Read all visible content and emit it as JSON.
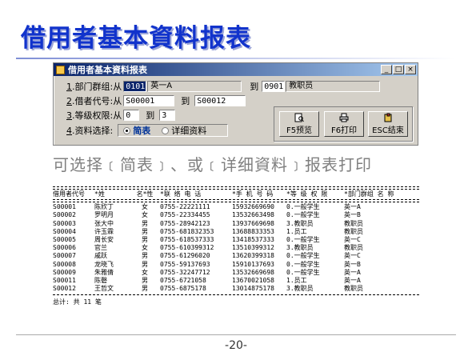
{
  "slide_title": "借用者基本資料报表",
  "window": {
    "title": "借用者基本資料报表",
    "buttons": [
      "_",
      "□",
      "×"
    ]
  },
  "form": {
    "dept": {
      "num": "1",
      "label": ".部门群组:从",
      "from_code": "0101",
      "from_name": "英一A",
      "to_label": "到",
      "to_code": "0901",
      "to_name": "教职员"
    },
    "borrower": {
      "num": "2",
      "label": ".借者代号:从",
      "from": "S00001",
      "to_label": "到",
      "to": "S00012"
    },
    "level": {
      "num": "3",
      "label": ".等级权限:从",
      "from": "0",
      "to_label": "到",
      "to": "3"
    },
    "data_select": {
      "num": "4",
      "label": ".资料选择:",
      "option1": "简表",
      "option2": "详细资料"
    }
  },
  "toolbar": {
    "preview": "F5预览",
    "print": "F6打印",
    "exit": "ESC结束"
  },
  "caption": "可选择﹝简表﹞、或﹝详细資料﹞报表打印",
  "report": {
    "headers": [
      "借用者代号",
      "*姓",
      "名*性",
      "*联  络    电  话",
      "*手  机    号  码",
      "*等 级   权 限",
      "*部门群组  名  称"
    ],
    "rows": [
      [
        "S00001",
        "陈欣丁",
        "女",
        "0755-22221111",
        "15932669690",
        "0.一般学生",
        "英一A"
      ],
      [
        "S00002",
        "罗明月",
        "女",
        "0755-22334455",
        "13532663498",
        "0.一般学生",
        "英一B"
      ],
      [
        "S00003",
        "张大中",
        "男",
        "0755-28942123",
        "13937669698",
        "3.教职员",
        "教职员"
      ],
      [
        "S00004",
        "许玉霖",
        "男",
        "0755-681832353",
        "13688833353",
        "1.员工",
        "教职员"
      ],
      [
        "S00005",
        "周长安",
        "男",
        "0755-618537333",
        "13418537333",
        "0.一般学生",
        "英一C"
      ],
      [
        "S00006",
        "官兰",
        "女",
        "0755-610399312",
        "13510399312",
        "3.教职员",
        "教职员"
      ],
      [
        "S00007",
        "戚跃",
        "男",
        "0755-61296020",
        "13620399318",
        "0.一般学生",
        "英一C"
      ],
      [
        "S00008",
        "龙晓飞",
        "男",
        "0755-59137693",
        "15910137693",
        "0.一般学生",
        "英一B"
      ],
      [
        "S00009",
        "朱雅倩",
        "女",
        "0755-32247712",
        "13532669698",
        "0.一般学生",
        "英一A"
      ],
      [
        "S00011",
        "陈磬",
        "男",
        "0755-6721058",
        "13670021058",
        "1.员工",
        "英一A"
      ],
      [
        "S00012",
        "王哲文",
        "男",
        "0755-6875178",
        "13014875178",
        "3.教职员",
        "教职员"
      ]
    ],
    "total": "总计: 共 11 笔"
  },
  "page_number": "-20-"
}
